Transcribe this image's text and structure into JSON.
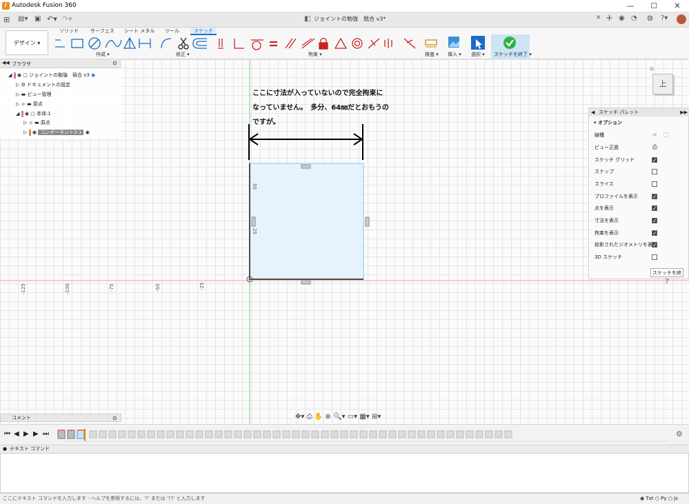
{
  "app": {
    "title": "Autodesk Fusion 360",
    "document_title": "ジョイントの勉強　競合 v3*"
  },
  "ribbon": {
    "workspace": "デザイン",
    "tabs": [
      "ソリッド",
      "サーフェス",
      "シート メタル",
      "ツール",
      "スケッチ"
    ],
    "active_tab": "スケッチ",
    "groups": {
      "create": "作成 ▾",
      "modify": "修正 ▾",
      "constraints": "拘束 ▾",
      "inspect": "検査 ▾",
      "insert": "挿入 ▾",
      "select": "選択 ▾",
      "finish": "スケッチを終了 ▾"
    }
  },
  "browser": {
    "header": "ブラウザ",
    "items": [
      "ジョイントの勉強　競合 v3",
      "ドキュメントの設定",
      "ビュー管理",
      "原点",
      "本体:1",
      "原点",
      "コンポーネント2:1"
    ]
  },
  "comment": {
    "label": "コメント"
  },
  "annotation": {
    "line1": "ここに寸法が入っていないので完全拘束に",
    "line2": "なっていません。　多分、64㎜だとおもうの",
    "line3": "ですが。"
  },
  "axis": {
    "x_ticks": [
      "-125",
      "-100",
      "-75",
      "-50",
      "-25"
    ],
    "y_ticks": [
      "50",
      "25"
    ]
  },
  "viewcube": {
    "label": "上"
  },
  "palette": {
    "title": "スケッチ パレット",
    "section": "オプション",
    "rows": [
      {
        "label": "線種",
        "kind": "icon"
      },
      {
        "label": "ビュー正面",
        "kind": "icon"
      },
      {
        "label": "スケッチ グリッド",
        "checked": true
      },
      {
        "label": "スナップ",
        "checked": false
      },
      {
        "label": "スライス",
        "checked": false
      },
      {
        "label": "プロファイルを表示",
        "checked": true
      },
      {
        "label": "点を表示",
        "checked": true
      },
      {
        "label": "寸法を表示",
        "checked": true
      },
      {
        "label": "拘束を表示",
        "checked": true
      },
      {
        "label": "投影されたジオメトリを表示",
        "checked": true
      },
      {
        "label": "3D スケッチ",
        "checked": false
      }
    ],
    "finish_button": "スケッチを終了"
  },
  "text_command": {
    "header": "テキスト コマンド",
    "placeholder": "ここにテキスト コマンドを入力します - ヘルプを参照するには、'?' または '??' と入力します",
    "modes": [
      "Txt",
      "Py",
      "Js"
    ],
    "selected_mode": "Txt"
  },
  "colors": {
    "accent": "#1b6ac9",
    "sketch_fill": "#d9ecfb",
    "finish_green": "#2db34a"
  }
}
